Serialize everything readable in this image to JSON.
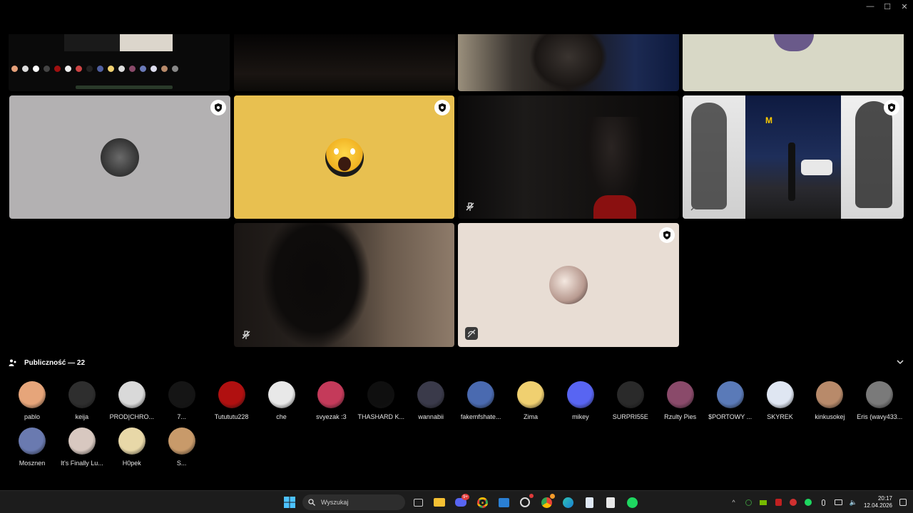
{
  "window": {
    "minimize": "—",
    "maximize": "☐",
    "close": "✕"
  },
  "audience": {
    "title": "Publiczność — 22",
    "members": [
      {
        "name": "pablo",
        "color": "#e6a57a"
      },
      {
        "name": "keija",
        "color": "#2e2e2e"
      },
      {
        "name": "PROD|CHRO...",
        "color": "#d9d9d9"
      },
      {
        "name": "7...",
        "color": "#151515"
      },
      {
        "name": "Tutututu228",
        "color": "#b01010"
      },
      {
        "name": "che",
        "color": "#e8e8e8"
      },
      {
        "name": "svyezak :3",
        "color": "#c43a5a"
      },
      {
        "name": "THASHARD K...",
        "color": "#0f0f0f"
      },
      {
        "name": "wannabii",
        "color": "#3a3a4a"
      },
      {
        "name": "fakemfshate...",
        "color": "#4a6ab0"
      },
      {
        "name": "Zima",
        "color": "#f0d070"
      },
      {
        "name": "mikey",
        "color": "#5865f2"
      },
      {
        "name": "SURPRI55E",
        "color": "#2a2a2a"
      },
      {
        "name": "Rzulty Pies",
        "color": "#8a4a6a"
      },
      {
        "name": "$PORTOWY ...",
        "color": "#5a7ab8"
      },
      {
        "name": "SKYREK",
        "color": "#dfe6f2"
      },
      {
        "name": "kinkusokej",
        "color": "#b88a6a"
      },
      {
        "name": "Eris (wavy433...",
        "color": "#7a7a7a"
      },
      {
        "name": "Mosznen",
        "color": "#6a7ab0"
      },
      {
        "name": "It's Finally Lu...",
        "color": "#d8c8c0"
      },
      {
        "name": "H0pek",
        "color": "#e8d8a8"
      },
      {
        "name": "S...",
        "color": "#c89a6a"
      }
    ]
  },
  "taskbar": {
    "search_placeholder": "Wyszukaj",
    "discord_badge": "9+",
    "time": "20:17",
    "date": "12.04.2026"
  }
}
